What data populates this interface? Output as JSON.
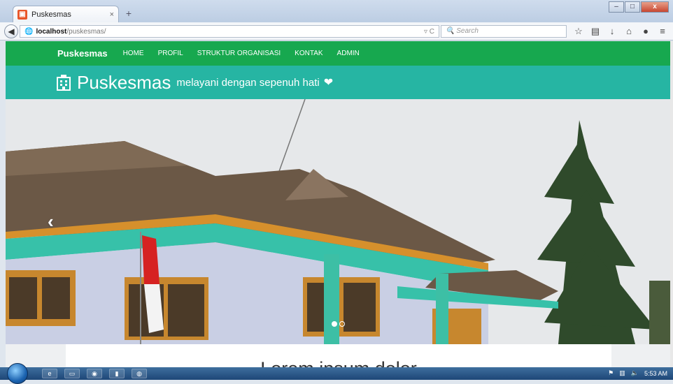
{
  "browser": {
    "tab_title": "Puskesmas",
    "tab_close": "×",
    "new_tab": "+",
    "url_host": "localhost",
    "url_path": "/puskesmas/",
    "search_placeholder": "Search",
    "minimize": "–",
    "maximize": "□",
    "close": "x"
  },
  "site": {
    "brand": "Puskesmas",
    "nav": [
      "HOME",
      "PROFIL",
      "STRUKTUR ORGANISASI",
      "KONTAK",
      "ADMIN"
    ],
    "hero_title": "Puskesmas",
    "hero_tagline": "melayani dengan sepenuh hati",
    "hero_heart": "❤",
    "carousel_prev": "‹",
    "content_heading": "Lorem ipsum dolor"
  },
  "taskbar": {
    "clock": "5:53 AM"
  },
  "colors": {
    "nav_green": "#17a84f",
    "hero_teal": "#26b5a3"
  }
}
